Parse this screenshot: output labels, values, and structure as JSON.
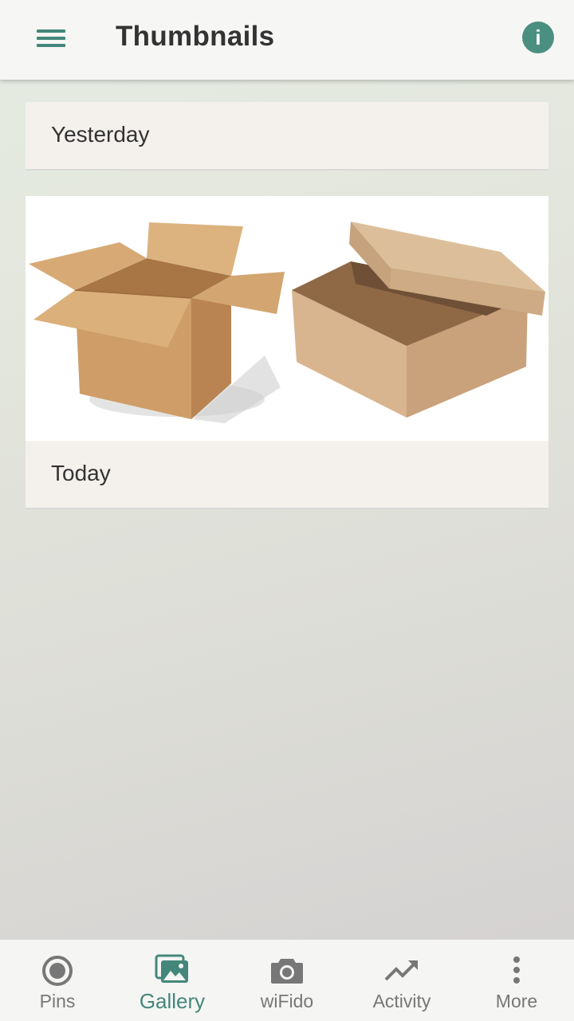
{
  "appbar": {
    "title": "Thumbnails"
  },
  "gallery": {
    "sections": [
      {
        "label": "Yesterday"
      },
      {
        "label": "Today"
      }
    ]
  },
  "bottom_nav": {
    "items": [
      {
        "label": "Pins",
        "icon": "target-icon"
      },
      {
        "label": "Gallery",
        "icon": "gallery-icon",
        "active": true
      },
      {
        "label": "wiFido",
        "icon": "camera-icon"
      },
      {
        "label": "Activity",
        "icon": "trending-up-icon"
      },
      {
        "label": "More",
        "icon": "more-vert-icon"
      }
    ]
  },
  "colors": {
    "accent": "#43877a",
    "card_bg": "#f4f1ed",
    "inactive_nav": "#777777"
  }
}
